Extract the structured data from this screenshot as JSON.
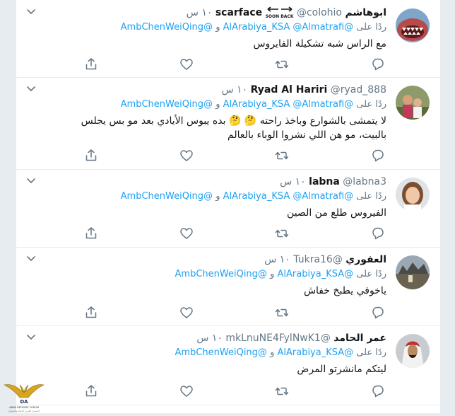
{
  "tweets": [
    {
      "name": "ابوهاشم",
      "name_extra": "scarface",
      "badge": "SOON BACK",
      "handle": "@colohio",
      "time": "١٠ س",
      "reply_prefix": "ردًا على",
      "reply_to": [
        "@AlArabiya_KSA",
        "@Almatrafi",
        "@AmbChenWeiQing"
      ],
      "reply_and": "و",
      "text": "مع الراس شبه تشكيلة الفايروس"
    },
    {
      "name": "Ryad Al Hariri",
      "handle": "@ryad_888",
      "time": "١٠ س",
      "reply_prefix": "ردًا على",
      "reply_to": [
        "@AlArabiya_KSA",
        "@Almatrafi",
        "@AmbChenWeiQing"
      ],
      "reply_and": "و",
      "text_line1_a": "لا يتمشى بالشوارع وباخذ راحته",
      "text_line1_b": "بده يبوس الأيادي بعد مو بس يجلس",
      "text_line2": "بالبيت، مو هن اللي نشروا الوباء بالعالم",
      "emoji": "🤔 🤔"
    },
    {
      "name": "labna",
      "handle": "@labna3",
      "time": "١٠ س",
      "reply_prefix": "ردًا على",
      "reply_to": [
        "@AlArabiya_KSA",
        "@Almatrafi",
        "@AmbChenWeiQing"
      ],
      "reply_and": "و",
      "text": "الفيروس طلع من الصين"
    },
    {
      "name": "العفوري",
      "handle": "@Tukra16",
      "time": "١٠ س",
      "reply_prefix": "ردًا على",
      "reply_to": [
        "@AlArabiya_KSA",
        "@AmbChenWeiQing"
      ],
      "reply_and": "و",
      "text": "ياخوفي يطبخ خفاش"
    },
    {
      "name": "عمر الحامد",
      "handle": "@mkLnuNE4FylNwK1",
      "time": "١٠ س",
      "reply_prefix": "ردًا على",
      "reply_to": [
        "@AlArabiya_KSA",
        "@AmbChenWeiQing"
      ],
      "reply_and": "و",
      "text": "ليتكم مانشرتو المرض"
    }
  ],
  "colors": {
    "link": "#1da1f2",
    "muted": "#657786",
    "divider": "#e6ecf0"
  },
  "watermark": {
    "title": "DA",
    "line1": "ARAB DEFENSE FORUM",
    "line2": "المنتدى العربي للدفاع والتسليح"
  }
}
